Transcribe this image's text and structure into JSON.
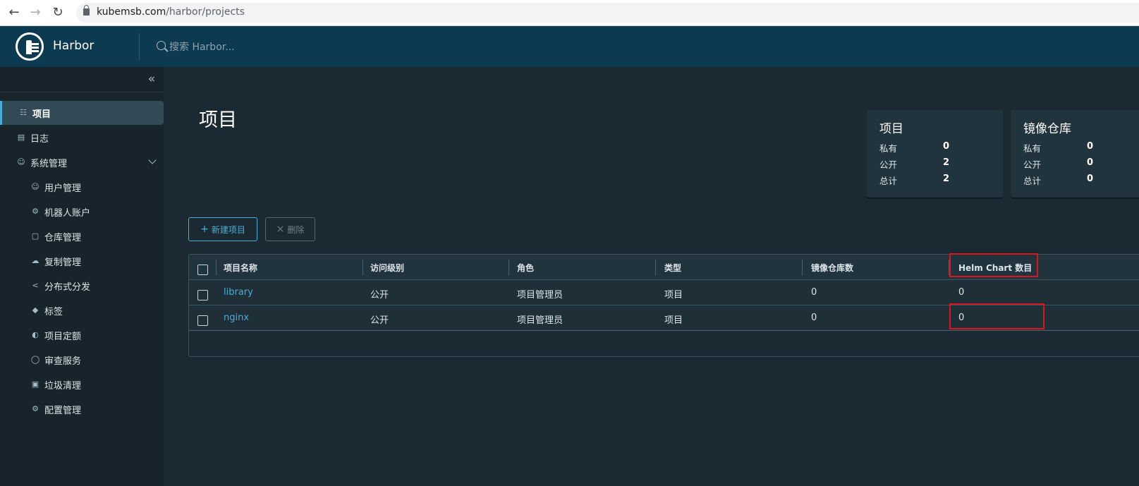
{
  "browser": {
    "url_domain": "kubemsb.com",
    "url_path": "/harbor/projects"
  },
  "header": {
    "app_name": "Harbor",
    "search_placeholder": "搜索 Harbor..."
  },
  "sidebar": {
    "items": [
      {
        "label": "项目",
        "icon": "projects-icon",
        "active": true
      },
      {
        "label": "日志",
        "icon": "logs-icon"
      },
      {
        "label": "系统管理",
        "icon": "admin-icon",
        "expandable": true
      },
      {
        "label": "用户管理",
        "icon": "users-icon"
      },
      {
        "label": "机器人账户",
        "icon": "robot-icon"
      },
      {
        "label": "仓库管理",
        "icon": "registry-icon"
      },
      {
        "label": "复制管理",
        "icon": "cloud-icon"
      },
      {
        "label": "分布式分发",
        "icon": "share-icon"
      },
      {
        "label": "标签",
        "icon": "tag-icon"
      },
      {
        "label": "项目定额",
        "icon": "gauge-icon"
      },
      {
        "label": "审查服务",
        "icon": "shield-icon"
      },
      {
        "label": "垃圾清理",
        "icon": "trash-icon"
      },
      {
        "label": "配置管理",
        "icon": "gear-icon"
      }
    ]
  },
  "main": {
    "title": "项目",
    "cards": [
      {
        "title": "项目",
        "rows": [
          {
            "label": "私有",
            "value": "0"
          },
          {
            "label": "公开",
            "value": "2"
          },
          {
            "label": "总计",
            "value": "2"
          }
        ]
      },
      {
        "title": "镜像仓库",
        "rows": [
          {
            "label": "私有",
            "value": "0"
          },
          {
            "label": "公开",
            "value": "0"
          },
          {
            "label": "总计",
            "value": "0"
          }
        ]
      }
    ],
    "new_button": "新建项目",
    "delete_button": "删除",
    "table": {
      "columns": [
        "项目名称",
        "访问级别",
        "角色",
        "类型",
        "镜像仓库数",
        "Helm Chart 数目"
      ],
      "rows": [
        [
          "library",
          "公开",
          "项目管理员",
          "项目",
          "0",
          "0"
        ],
        [
          "nginx",
          "公开",
          "项目管理员",
          "项目",
          "0",
          "0"
        ]
      ]
    },
    "highlight_color": "#e0141e"
  }
}
